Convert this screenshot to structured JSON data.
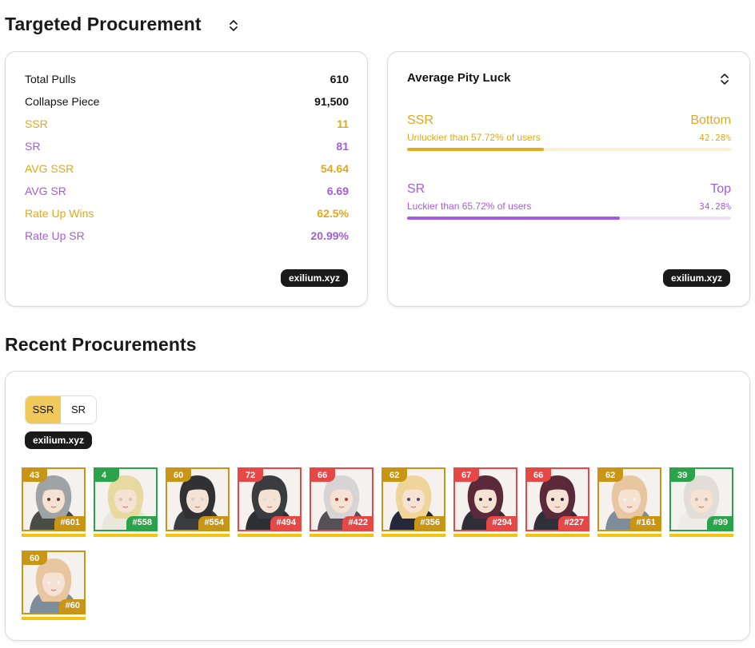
{
  "header": {
    "title": "Targeted Procurement",
    "sort_icon": "chevron-up-down-icon"
  },
  "stats": {
    "rows": [
      {
        "label": "Total Pulls",
        "value": "610",
        "tone": "black"
      },
      {
        "label": "Collapse Piece",
        "value": "91,500",
        "tone": "black"
      },
      {
        "label": "SSR",
        "value": "11",
        "tone": "gold"
      },
      {
        "label": "SR",
        "value": "81",
        "tone": "purple"
      },
      {
        "label": "AVG SSR",
        "value": "54.64",
        "tone": "gold"
      },
      {
        "label": "AVG SR",
        "value": "6.69",
        "tone": "purple"
      },
      {
        "label": "Rate Up Wins",
        "value": "62.5%",
        "tone": "gold"
      },
      {
        "label": "Rate Up SR",
        "value": "20.99%",
        "tone": "purple"
      }
    ],
    "badge": "exilium.xyz"
  },
  "luck": {
    "title": "Average Pity Luck",
    "sort_icon": "chevron-up-down-icon",
    "ssr": {
      "name": "SSR",
      "rank": "Bottom",
      "desc": "Unluckier than 57.72% of users",
      "pct": "42.28%",
      "fill": 0.4228
    },
    "sr": {
      "name": "SR",
      "rank": "Top",
      "desc": "Luckier than 65.72% of users",
      "pct": "34.28%",
      "fill": 0.6572
    },
    "badge": "exilium.xyz"
  },
  "recent": {
    "title": "Recent Procurements",
    "toggle": {
      "options": [
        "SSR",
        "SR"
      ],
      "selected": "SSR"
    },
    "badge": "exilium.xyz",
    "items": [
      {
        "pity": "43",
        "number": "#601",
        "status": "gold"
      },
      {
        "pity": "4",
        "number": "#558",
        "status": "green"
      },
      {
        "pity": "60",
        "number": "#554",
        "status": "gold"
      },
      {
        "pity": "72",
        "number": "#494",
        "status": "red"
      },
      {
        "pity": "66",
        "number": "#422",
        "status": "red"
      },
      {
        "pity": "62",
        "number": "#356",
        "status": "gold"
      },
      {
        "pity": "67",
        "number": "#294",
        "status": "red"
      },
      {
        "pity": "66",
        "number": "#227",
        "status": "red"
      },
      {
        "pity": "62",
        "number": "#161",
        "status": "gold"
      },
      {
        "pity": "39",
        "number": "#99",
        "status": "green"
      },
      {
        "pity": "60",
        "number": "#60",
        "status": "gold"
      }
    ]
  },
  "colors": {
    "gold": "#e0a91a",
    "purple": "#a45be0",
    "win_green": "#2aa34a",
    "loss_red": "#e64848",
    "pity_gold": "#c89516",
    "bar_yellow": "#f2c30f"
  }
}
